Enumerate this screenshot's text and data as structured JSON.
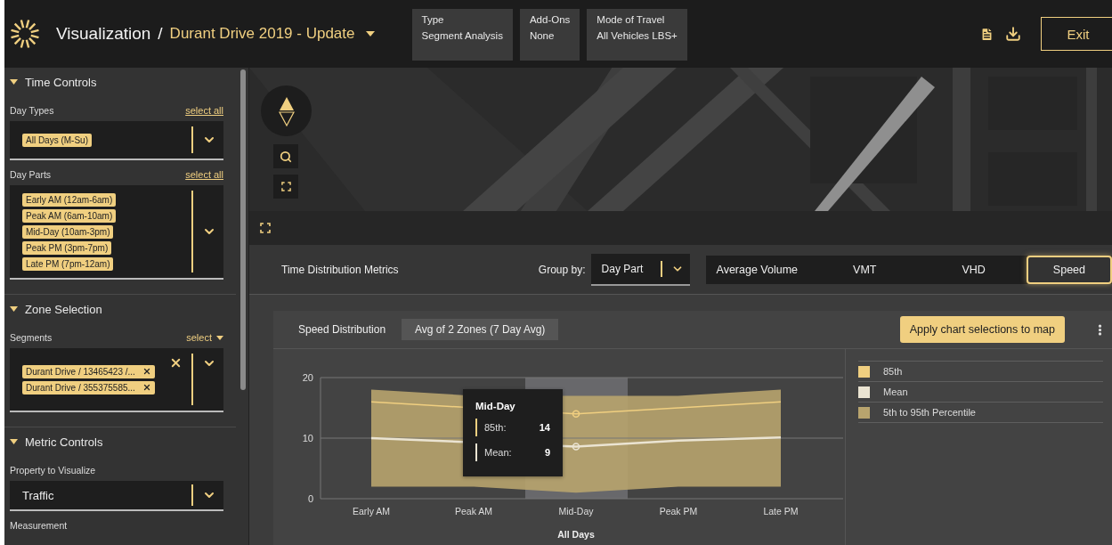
{
  "header": {
    "title": "Visualization",
    "separator": "/",
    "project": "Durant Drive 2019 - Update",
    "info": [
      {
        "label": "Type",
        "value": "Segment Analysis"
      },
      {
        "label": "Add-Ons",
        "value": "None"
      },
      {
        "label": "Mode of Travel",
        "value": "All Vehicles LBS+"
      }
    ],
    "exit": "Exit"
  },
  "sidebar": {
    "sections": [
      {
        "title": "Time Controls",
        "expanded": true,
        "fields": [
          {
            "kind": "tags",
            "label": "Day Types",
            "action": {
              "kind": "link",
              "text": "select all"
            },
            "tags": [
              {
                "text": "All Days (M-Su)",
                "removable": false
              }
            ]
          },
          {
            "kind": "tags",
            "label": "Day Parts",
            "action": {
              "kind": "link",
              "text": "select all"
            },
            "tags": [
              {
                "text": "Early AM (12am-6am)",
                "removable": false
              },
              {
                "text": "Peak AM (6am-10am)",
                "removable": false
              },
              {
                "text": "Mid-Day (10am-3pm)",
                "removable": false
              },
              {
                "text": "Peak PM (3pm-7pm)",
                "removable": false
              },
              {
                "text": "Late PM (7pm-12am)",
                "removable": false
              }
            ]
          }
        ]
      },
      {
        "title": "Zone Selection",
        "expanded": true,
        "fields": [
          {
            "kind": "tags",
            "label": "Segments",
            "action": {
              "kind": "menu",
              "text": "select"
            },
            "clearable": true,
            "tags": [
              {
                "text": "Durant Drive / 13465423 /...",
                "removable": true
              },
              {
                "text": "Durant Drive / 355375585...",
                "removable": true
              }
            ]
          }
        ]
      },
      {
        "title": "Metric Controls",
        "expanded": true,
        "fields": [
          {
            "kind": "select",
            "label": "Property to Visualize",
            "value": "Traffic"
          },
          {
            "kind": "label",
            "label": "Measurement"
          }
        ]
      }
    ]
  },
  "metrics": {
    "title": "Time Distribution Metrics",
    "group_by": {
      "label": "Group by:",
      "value": "Day Part"
    },
    "options": [
      {
        "label": "Average Volume",
        "selected": false
      },
      {
        "label": "VMT",
        "selected": false
      },
      {
        "label": "VHD",
        "selected": false
      },
      {
        "label": "Speed",
        "selected": true
      }
    ]
  },
  "card": {
    "title": "Speed Distribution",
    "chip": "Avg of 2 Zones (7 Day Avg)",
    "apply": "Apply chart selections to map",
    "chart_data": {
      "type": "line",
      "xlabel": "All Days",
      "categories": [
        "Early AM",
        "Peak AM",
        "Mid-Day",
        "Peak PM",
        "Late PM"
      ],
      "ylim": [
        0,
        20
      ],
      "yticks": [
        0,
        10,
        20
      ],
      "series": [
        {
          "name": "85th",
          "color": "#f0cf80",
          "values": [
            16,
            null,
            14,
            15,
            16
          ]
        },
        {
          "name": "Mean",
          "color": "#ebe4d2",
          "values": [
            10,
            null,
            8.6,
            9.6,
            10.1
          ]
        }
      ]
    },
    "band_legend": {
      "label": "5th to 95th Percentile",
      "color": "#b8a46e"
    },
    "tooltip": {
      "title": "Mid-Day",
      "rows": [
        {
          "label": "85th:",
          "value": "14",
          "color": "#f0cf80"
        },
        {
          "label": "Mean:",
          "value": "9",
          "color": "#ebe4d2"
        }
      ]
    }
  }
}
